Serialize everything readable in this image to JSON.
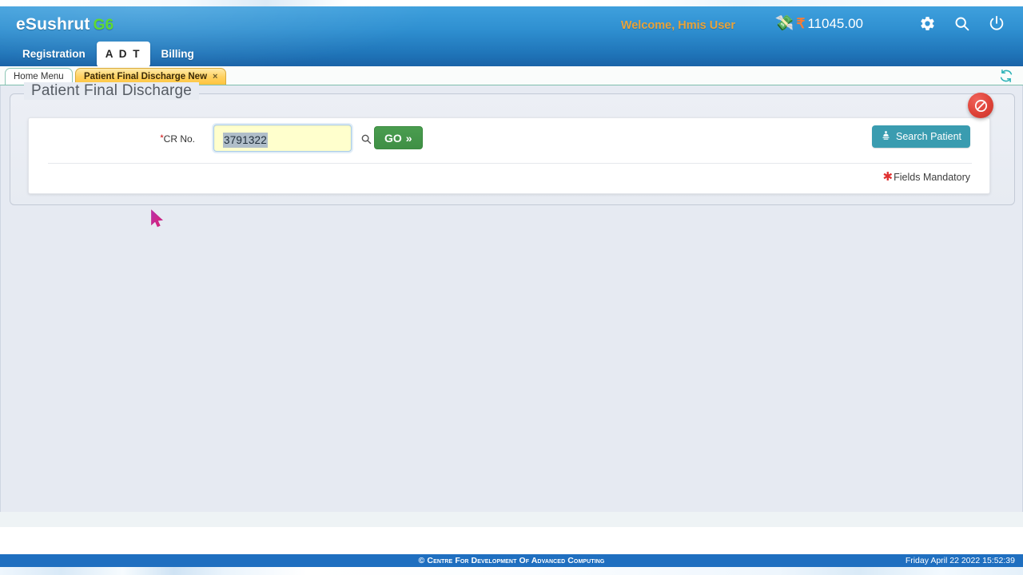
{
  "header": {
    "brand_name": "eSushrut",
    "brand_suffix": "G6",
    "nav": [
      {
        "label": "Registration",
        "active": false
      },
      {
        "label": "A D T",
        "active": true
      },
      {
        "label": "Billing",
        "active": false
      }
    ],
    "welcome_text": "Welcome, Hmis User",
    "cash_icon": "money-icon",
    "currency_symbol": "₹",
    "balance_amount": "11045.00",
    "icons": [
      {
        "name": "gear-icon",
        "label": "Settings"
      },
      {
        "name": "search-icon",
        "label": "Search"
      },
      {
        "name": "power-icon",
        "label": "Logout"
      }
    ],
    "accent_blue": "#2f90d1",
    "welcome_color": "#e8a33b",
    "brand_green": "#5ed932"
  },
  "tabs": {
    "items": [
      {
        "label": "Home Menu",
        "active": false,
        "closable": false
      },
      {
        "label": "Patient Final Discharge New",
        "active": true,
        "closable": true,
        "close_glyph": "×"
      }
    ],
    "refresh_icon": "refresh-icon"
  },
  "page": {
    "title": "Patient Final Discharge",
    "close_button": {
      "name": "block-button",
      "glyph": "⊘",
      "color": "#de4338"
    }
  },
  "form": {
    "cr_label": "CR No.",
    "cr_required_marker": "*",
    "cr_value": "3791322",
    "cr_placeholder": "",
    "search_glass_icon": "magnifier-icon",
    "go_label": "GO",
    "go_chevron": "»",
    "go_color": "#3f8f45",
    "search_patient_label": "Search Patient",
    "search_patient_icon": "patient-search-icon",
    "search_patient_color": "#3a9cb0",
    "mandatory_marker": "✱",
    "mandatory_text": "Fields Mandatory"
  },
  "footer": {
    "copyright": "© Centre For Development Of Advanced Computing",
    "timestamp": "Friday April 22 2022 15:52:39",
    "bar_color": "#1f6fc0"
  },
  "cursor": {
    "name": "mouse-pointer",
    "color": "#d6256f"
  }
}
